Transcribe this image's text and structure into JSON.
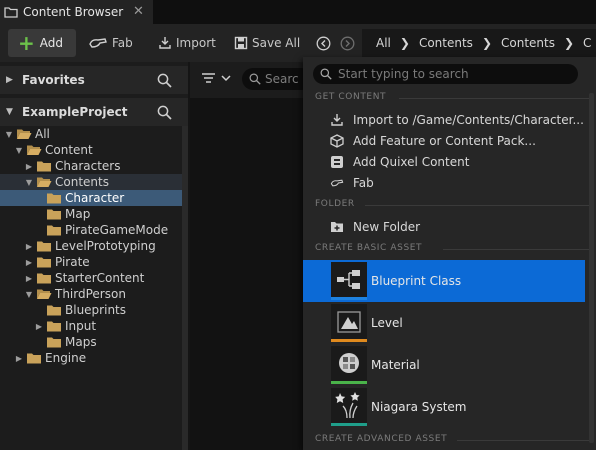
{
  "tab": {
    "title": "Content Browser",
    "close": "✕"
  },
  "toolbar": {
    "add_label": "Add",
    "fab_label": "Fab",
    "import_label": "Import",
    "save_all_label": "Save All",
    "breadcrumbs": [
      "All",
      "Contents",
      "Contents",
      "C"
    ]
  },
  "left_panel": {
    "favorites_label": "Favorites",
    "project_label": "ExampleProject",
    "tree": [
      {
        "label": "All",
        "depth": 0,
        "expanded": true
      },
      {
        "label": "Content",
        "depth": 1,
        "expanded": true
      },
      {
        "label": "Characters",
        "depth": 2,
        "expanded": false
      },
      {
        "label": "Contents",
        "depth": 2,
        "expanded": true
      },
      {
        "label": "Character",
        "depth": 3,
        "selected": true
      },
      {
        "label": "Map",
        "depth": 3
      },
      {
        "label": "PirateGameMode",
        "depth": 3
      },
      {
        "label": "LevelPrototyping",
        "depth": 2,
        "expanded": false
      },
      {
        "label": "Pirate",
        "depth": 2,
        "expanded": false
      },
      {
        "label": "StarterContent",
        "depth": 2,
        "expanded": false
      },
      {
        "label": "ThirdPerson",
        "depth": 2,
        "expanded": true
      },
      {
        "label": "Blueprints",
        "depth": 3
      },
      {
        "label": "Input",
        "depth": 3,
        "expanded": false
      },
      {
        "label": "Maps",
        "depth": 3
      },
      {
        "label": "Engine",
        "depth": 1,
        "expanded": false
      }
    ]
  },
  "content": {
    "search_placeholder": "Searc"
  },
  "menu": {
    "search_placeholder": "Start typing to search",
    "sections": {
      "get_content": "GET CONTENT",
      "folder": "FOLDER",
      "create_basic": "CREATE BASIC ASSET",
      "create_advanced": "CREATE ADVANCED ASSET"
    },
    "get_content_items": [
      {
        "label": "Import to /Game/Contents/Character...",
        "icon": "import-icon"
      },
      {
        "label": "Add Feature or Content Pack...",
        "icon": "feature-pack-icon"
      },
      {
        "label": "Add Quixel Content",
        "icon": "quixel-icon"
      },
      {
        "label": "Fab",
        "icon": "fab-icon"
      }
    ],
    "new_folder_label": "New Folder",
    "basic_assets": [
      {
        "label": "Blueprint Class",
        "color": "#1e82e0",
        "selected": true
      },
      {
        "label": "Level",
        "color": "#e08a1e"
      },
      {
        "label": "Material",
        "color": "#4ab34a"
      },
      {
        "label": "Niagara System",
        "color": "#1f9e8a"
      }
    ]
  },
  "colors": {
    "accent": "#0c6ad6",
    "selection": "#3c5a78",
    "folder": "#c9a25a",
    "add_plus": "#6cc24a"
  }
}
